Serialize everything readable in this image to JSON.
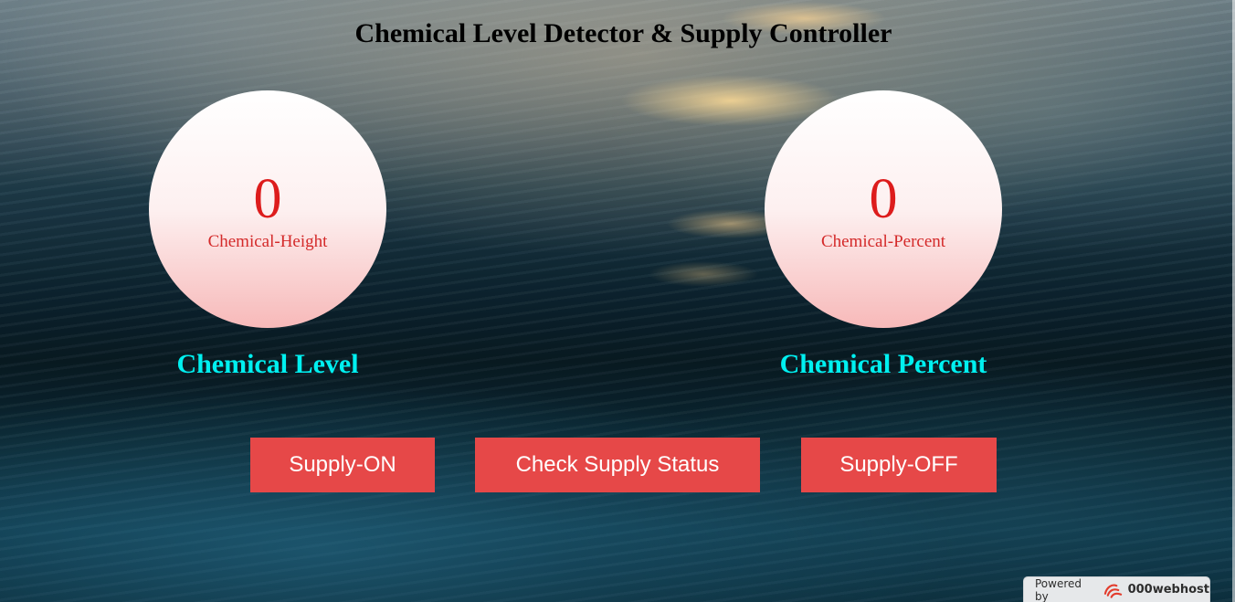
{
  "page": {
    "title": "Chemical Level Detector & Supply Controller"
  },
  "gauges": [
    {
      "value": "0",
      "unit_label": "Chemical-Height",
      "caption": "Chemical Level"
    },
    {
      "value": "0",
      "unit_label": "Chemical-Percent",
      "caption": "Chemical Percent"
    }
  ],
  "controls": {
    "supply_on_label": "Supply-ON",
    "check_status_label": "Check Supply Status",
    "supply_off_label": "Supply-OFF"
  },
  "footer_badge": {
    "powered_by": "Powered by",
    "brand": "000webhost",
    "icon": "000webhost-logo-icon"
  },
  "colors": {
    "title_text": "#000000",
    "gauge_value": "#dd1c1c",
    "gauge_caption": "#00f0f0",
    "button_background": "#e64848",
    "button_text": "#ffffff"
  }
}
